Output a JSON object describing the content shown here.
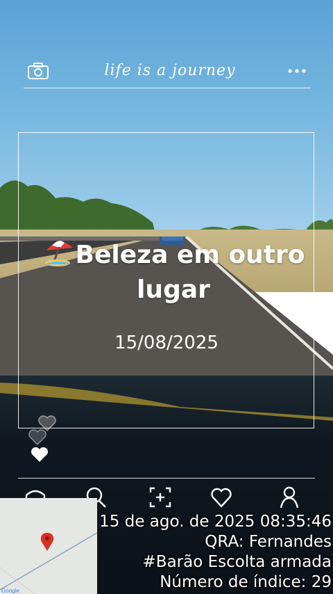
{
  "header": {
    "motto": "life is a journey",
    "icons": {
      "camera": "camera-icon",
      "more": "more-dots-icon"
    }
  },
  "post": {
    "title_emoji": "beach-umbrella-emoji",
    "title": "Beleza em outro lugar",
    "date": "15/08/2025"
  },
  "reactions": {
    "icons": [
      "heart-outline-icon",
      "heart-outline-icon",
      "heart-filled-icon"
    ]
  },
  "nav": {
    "icons": [
      "home-icon",
      "search-icon",
      "add-photo-icon",
      "favorites-icon",
      "profile-icon"
    ]
  },
  "overlay": {
    "timestamp": "15 de ago. de 2025 08:35:46",
    "qra": "QRA:  Fernandes",
    "tag": "#Barão Escolta armada",
    "index": "Número de índice: 29"
  },
  "map": {
    "pin_color": "#d93025",
    "attribution": "Google"
  }
}
